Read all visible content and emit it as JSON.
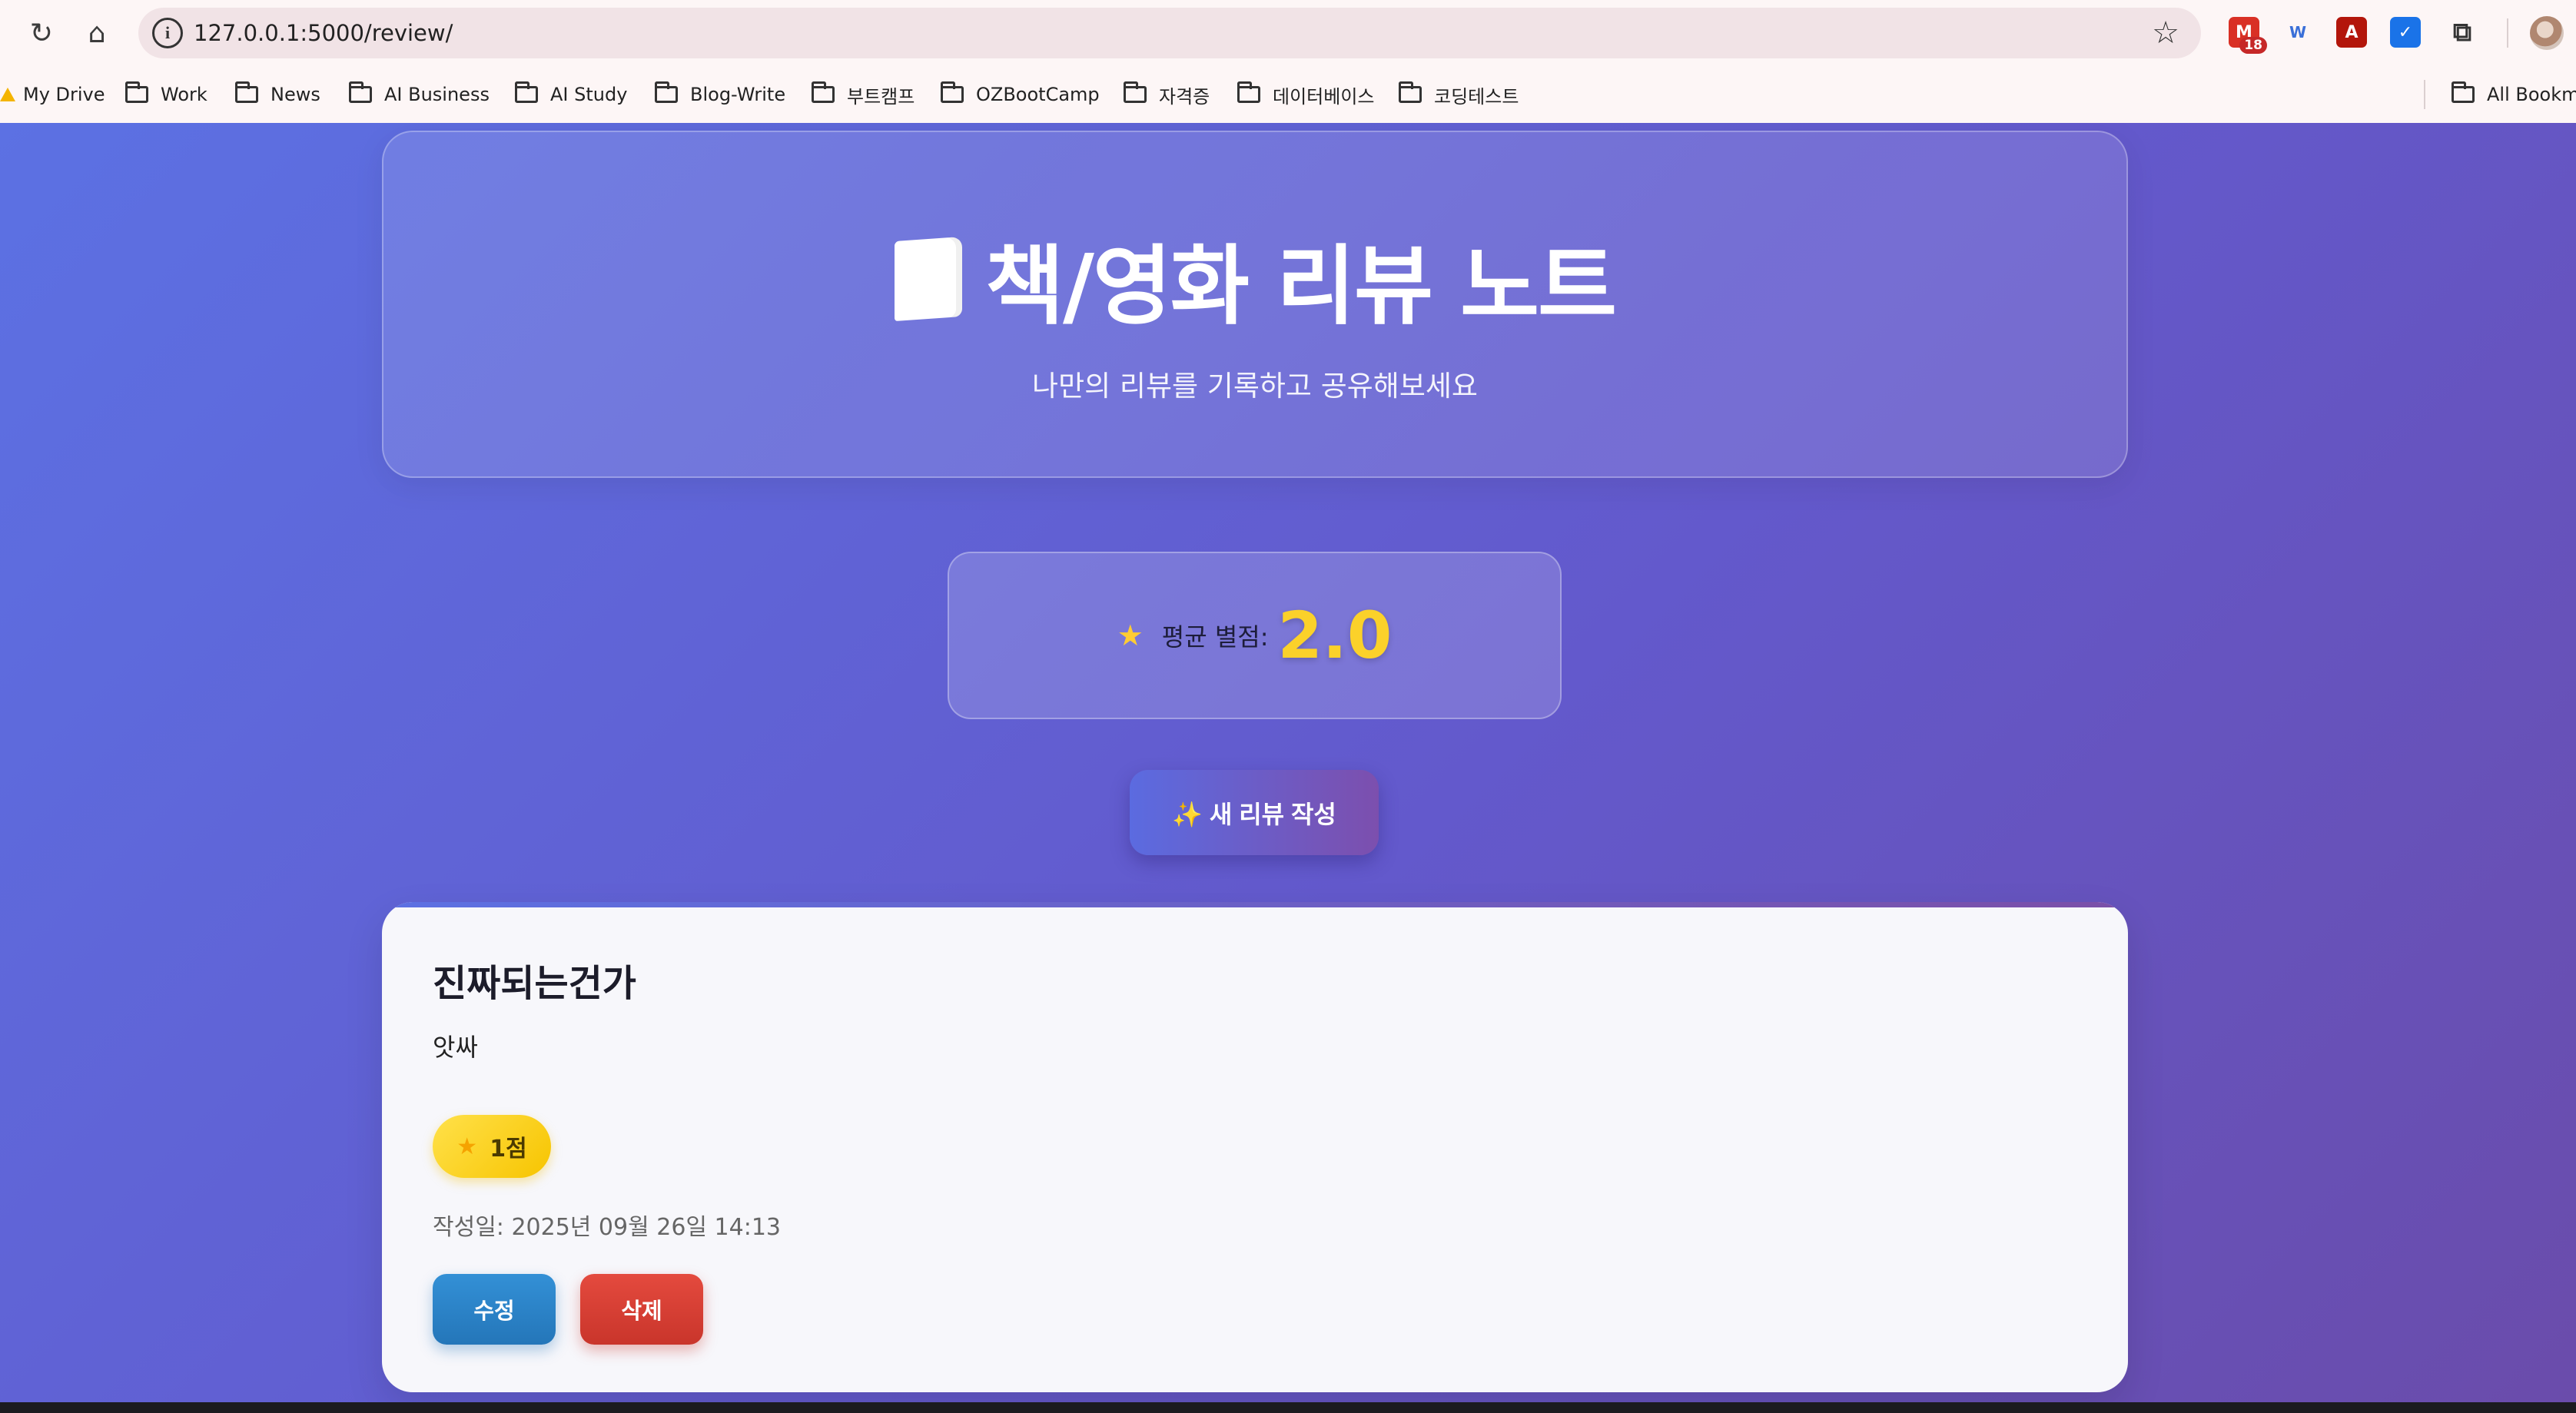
{
  "browser": {
    "url": "127.0.0.1:5000/review/",
    "gmail_badge": "18",
    "ext_letters": {
      "wh": "W",
      "pdf": "A"
    }
  },
  "bookmarks": {
    "items": [
      "My Drive",
      "Work",
      "News",
      "AI Business",
      "AI Study",
      "Blog-Write",
      "부트캠프",
      "OZBootCamp",
      "자격증",
      "데이터베이스",
      "코딩테스트"
    ],
    "all_bookmarks": "All Bookm"
  },
  "hero": {
    "title": "책/영화 리뷰 노트",
    "subtitle": "나만의 리뷰를 기록하고 공유해보세요"
  },
  "average": {
    "label": "평균 별점:",
    "value": "2.0"
  },
  "new_review_button": "✨ 새 리뷰 작성",
  "reviews": [
    {
      "title": "진짜되는건가",
      "body": "앗싸",
      "rating_label": "1점",
      "date": "작성일: 2025년 09월 26일 14:13",
      "edit_label": "수정",
      "delete_label": "삭제"
    }
  ],
  "colors": {
    "bg_start": "#5c71e3",
    "bg_end": "#6a4cab",
    "star": "#fbd12a",
    "edit": "#2476b9",
    "delete": "#c9352b"
  }
}
